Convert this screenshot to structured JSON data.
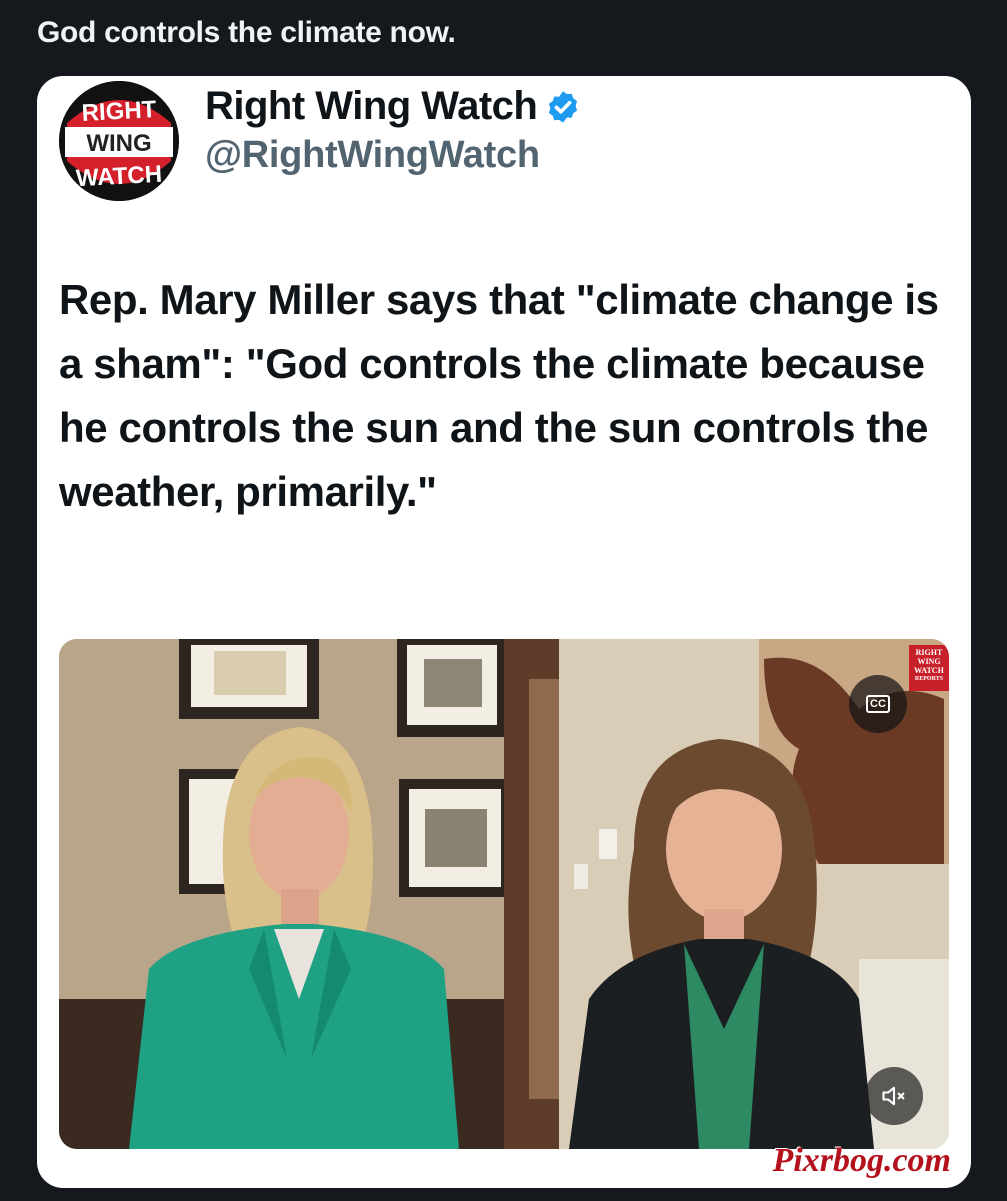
{
  "post": {
    "caption": "God controls the climate now."
  },
  "tweet": {
    "account_name": "Right Wing Watch",
    "handle": "@RightWingWatch",
    "verified": true,
    "text": "Rep. Mary Miller says that \"climate change is a sham\": \"God controls the climate because he controls the sun and the sun controls the weather, primarily.\"",
    "avatar": {
      "line1": "RIGHT",
      "line2": "WING",
      "line3": "WATCH"
    }
  },
  "video": {
    "badge": {
      "line1": "RIGHT",
      "line2": "WING",
      "line3": "WATCH",
      "line4": "REPORTS"
    },
    "cc_label": "CC",
    "icons": {
      "captions": "closed-captions-icon",
      "mute": "speaker-muted-icon"
    }
  },
  "watermark": "Pixrbog.com",
  "colors": {
    "background": "#15181d",
    "card": "#ffffff",
    "verified": "#1d9bf0",
    "brand_red": "#c8202b",
    "watermark": "#b3121c"
  }
}
